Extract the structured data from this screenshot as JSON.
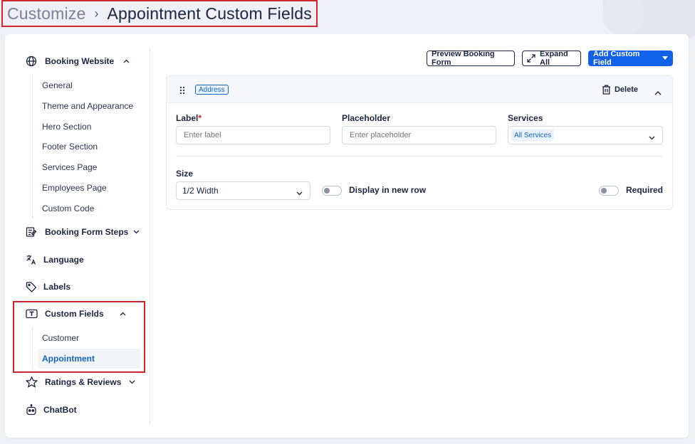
{
  "breadcrumb": {
    "parent": "Customize",
    "separator": "›",
    "current": "Appointment Custom Fields"
  },
  "sidebar": {
    "booking_website": {
      "label": "Booking Website",
      "items": [
        "General",
        "Theme and Appearance",
        "Hero Section",
        "Footer Section",
        "Services Page",
        "Employees Page",
        "Custom Code"
      ]
    },
    "booking_form_steps": {
      "label": "Booking Form Steps"
    },
    "language": {
      "label": "Language"
    },
    "labels": {
      "label": "Labels"
    },
    "custom_fields": {
      "label": "Custom Fields",
      "items": [
        "Customer",
        "Appointment"
      ],
      "active_item": "Appointment"
    },
    "ratings_reviews": {
      "label": "Ratings & Reviews"
    },
    "chatbot": {
      "label": "ChatBot"
    }
  },
  "toolbar": {
    "preview_label": "Preview Booking Form",
    "expand_label": "Expand All",
    "add_label": "Add Custom Field"
  },
  "field_card": {
    "type_tag": "Address",
    "delete_label": "Delete",
    "label_field": {
      "label": "Label",
      "required_mark": "*",
      "placeholder": "Enter label"
    },
    "placeholder_field": {
      "label": "Placeholder",
      "placeholder": "Enter placeholder"
    },
    "services_field": {
      "label": "Services",
      "selected": "All Services"
    },
    "size_field": {
      "label": "Size",
      "selected": "1/2 Width"
    },
    "display_new_row": {
      "label": "Display in new row",
      "on": false
    },
    "required": {
      "label": "Required",
      "on": false
    }
  },
  "colors": {
    "primary": "#1160e8",
    "highlight": "#d0242b",
    "active_text": "#1565c0"
  },
  "icons": [
    "globe-icon",
    "form-steps-icon",
    "translate-icon",
    "tag-icon",
    "text-field-icon",
    "star-icon",
    "robot-icon",
    "expand-icon",
    "caret-down-icon",
    "drag-handle-icon",
    "trash-icon",
    "chevron-up-icon",
    "chevron-down-icon"
  ]
}
